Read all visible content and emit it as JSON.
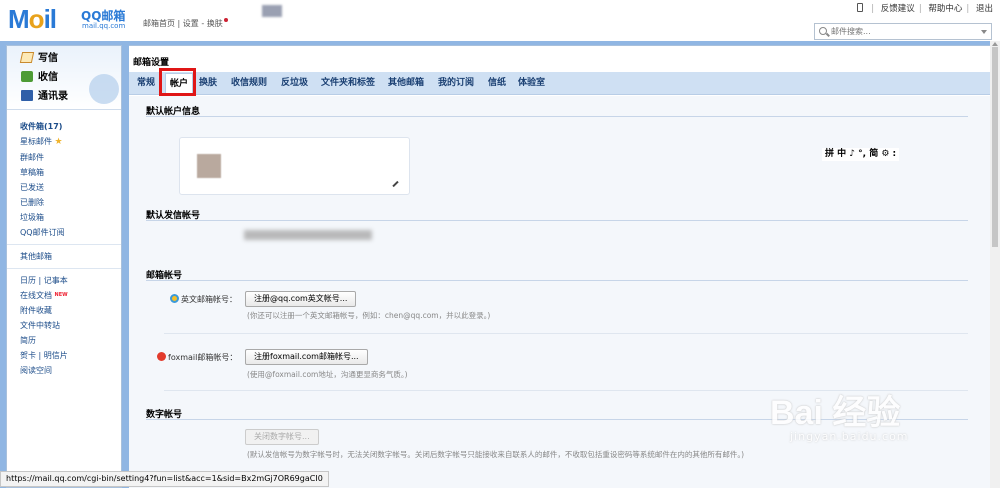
{
  "app": {
    "logo_main": "M",
    "logo_o": "o",
    "logo_rest": "il",
    "logo_brand": "QQ邮箱",
    "logo_domain": "mail.qq.com",
    "nav_text": "邮箱首页 | 设置 - 换肤"
  },
  "top_links": [
    "反馈建议",
    "帮助中心",
    "退出"
  ],
  "search": {
    "placeholder": "邮件搜索..."
  },
  "sidebar": {
    "quick": [
      "写信",
      "收信",
      "通讯录"
    ],
    "inbox": "收件箱(17)",
    "folders_a": [
      "星标邮件",
      "群邮件",
      "草稿箱",
      "已发送",
      "已删除",
      "垃圾箱",
      "QQ邮件订阅"
    ],
    "other_mailbox": "其他邮箱",
    "calendar": "日历",
    "notes": "记事本",
    "docs": "在线文档",
    "new_badge": "NEW",
    "folders_b": [
      "附件收藏",
      "文件中转站",
      "简历"
    ],
    "card": "贺卡",
    "postcard": "明信片",
    "reading": "阅读空间"
  },
  "main": {
    "title": "邮箱设置",
    "tabs": [
      "常规",
      "帐户",
      "换肤",
      "收信规则",
      "反垃圾",
      "文件夹和标签",
      "其他邮箱",
      "我的订阅",
      "信纸",
      "体验室"
    ],
    "active_tab": 1,
    "sections": {
      "default_account": "默认帐户信息",
      "default_sender": "默认发信帐号",
      "mailbox_account": "邮箱帐号",
      "digital_account": "数字帐号"
    },
    "ime_bar": "拼 中 ♪ °, 简 ⚙ :",
    "english_label": "英文邮箱帐号：",
    "english_button": "注册@qq.com英文帐号...",
    "english_hint": "(你还可以注册一个英文邮箱帐号，例如：chen@qq.com，并以此登录。)",
    "foxmail_label": "foxmail邮箱帐号：",
    "foxmail_button": "注册foxmail.com邮箱帐号...",
    "foxmail_hint": "(使用@foxmail.com地址，沟通更显商务气质。)",
    "digital_button": "关闭数字帐号...",
    "digital_hint": "(默认发信帐号为数字帐号时，无法关闭数字帐号。关闭后数字帐号只能接收来自联系人的邮件，不收取包括重设密码等系统邮件在内的其他所有邮件。)"
  },
  "status_url": "https://mail.qq.com/cgi-bin/setting4?fun=list&acc=1&sid=Bx2mGj7OR69gaCI0",
  "watermark": {
    "big": "Bai 经验",
    "small": "jingyan.baidu.com"
  },
  "colors": {
    "frame": "#90b6e3",
    "tabbar": "#cfe0f3",
    "highlight": "#e01616",
    "link": "#1d4d8a"
  }
}
